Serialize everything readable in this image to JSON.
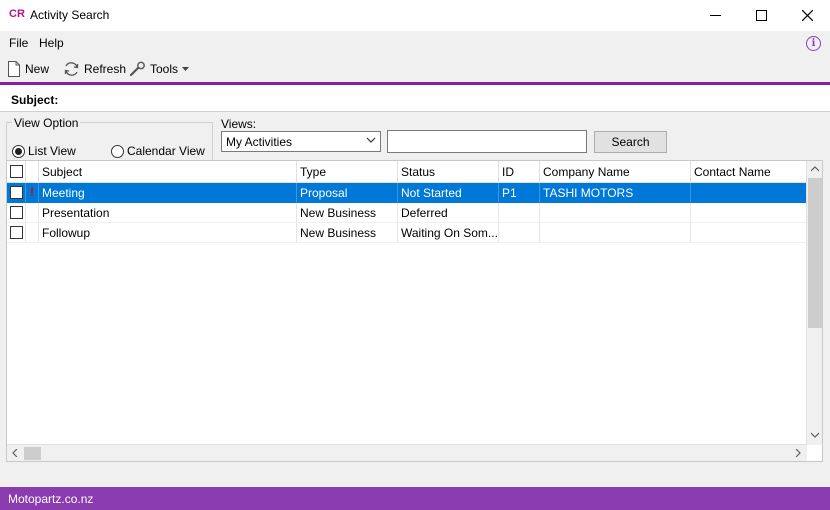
{
  "window": {
    "app_badge": "CR",
    "title": "Activity Search",
    "minimize": "—",
    "maximize": "☐",
    "close": "✕"
  },
  "menu": {
    "file": "File",
    "help": "Help",
    "info": "i"
  },
  "toolbar": {
    "new_label": "New",
    "refresh_label": "Refresh",
    "tools_label": "Tools"
  },
  "subject_label": "Subject:",
  "view_option": {
    "legend": "View Option",
    "list_view": "List View",
    "calendar_view": "Calendar View",
    "selected": "List View"
  },
  "views": {
    "label": "Views:",
    "selected": "My Activities",
    "search_value": "",
    "search_button": "Search"
  },
  "grid": {
    "columns": [
      "Subject",
      "Type",
      "Status",
      "ID",
      "Company Name",
      "Contact Name"
    ],
    "rows": [
      {
        "flag": "!",
        "subject": "Meeting",
        "type": "Proposal",
        "status": "Not Started",
        "id": "P1",
        "company": "TASHI MOTORS",
        "contact": "",
        "selected": true
      },
      {
        "flag": "",
        "subject": "Presentation",
        "type": "New Business",
        "status": "Deferred",
        "id": "",
        "company": "",
        "contact": "",
        "selected": false
      },
      {
        "flag": "",
        "subject": "Followup",
        "type": "New Business",
        "status": "Waiting On Som...",
        "id": "",
        "company": "",
        "contact": "",
        "selected": false
      }
    ]
  },
  "status_bar": {
    "text": "Motopartz.co.nz"
  },
  "colors": {
    "accent": "#8b3bb0",
    "selection": "#0078d7",
    "flag": "#dd0000"
  }
}
